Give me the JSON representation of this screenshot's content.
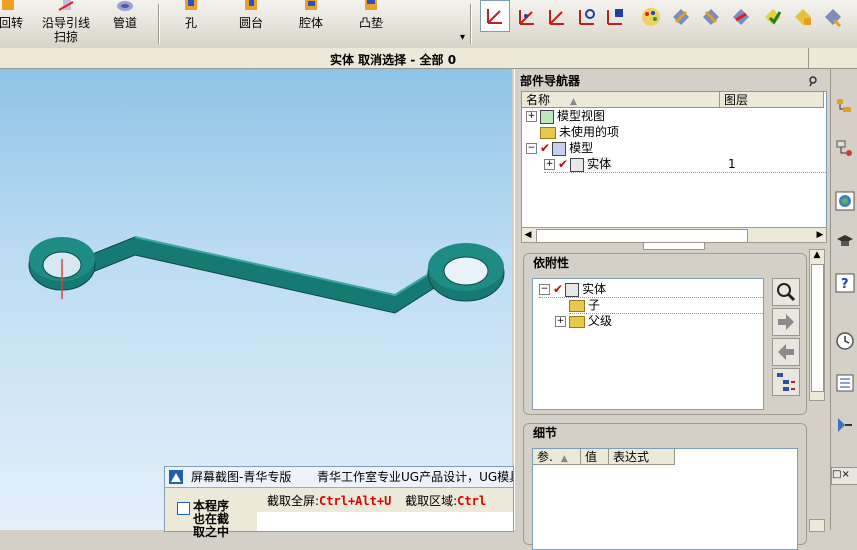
{
  "toolbar": {
    "buttons": [
      {
        "label": "回转",
        "icon": "revolve-icon"
      },
      {
        "label": "沿导引线\n扫掠",
        "icon": "sweep-along-guide-icon"
      },
      {
        "label": "管道",
        "icon": "tube-icon"
      },
      {
        "label": "孔",
        "icon": "hole-icon"
      },
      {
        "label": "圆台",
        "icon": "boss-icon"
      },
      {
        "label": "腔体",
        "icon": "pocket-icon"
      },
      {
        "label": "凸垫",
        "icon": "pad-icon"
      }
    ],
    "dropdown": "▾"
  },
  "status": {
    "text": "实体 取消选择 - 全部 0"
  },
  "navigator": {
    "title": "部件导航器",
    "columns": {
      "name": "名称",
      "layer": "图层"
    },
    "tree": [
      {
        "expander": "+",
        "label": "模型视图",
        "checked": false
      },
      {
        "expander": "",
        "label": "未使用的项",
        "checked": false
      },
      {
        "expander": "−",
        "label": "模型",
        "checked": true
      },
      {
        "expander": "+",
        "label": "实体",
        "checked": true,
        "layer": "1"
      }
    ]
  },
  "dependency": {
    "title": "依附性",
    "tree": [
      {
        "expander": "−",
        "label": "实体",
        "checked": true
      },
      {
        "expander": "",
        "label": "子"
      },
      {
        "expander": "+",
        "label": "父级"
      }
    ]
  },
  "details": {
    "title": "细节",
    "columns": [
      "参.",
      "值",
      "表达式"
    ]
  },
  "capture": {
    "title": "屏幕截图-青华专版",
    "subtitle": "青华工作室专业UG产品设计，UG模具设",
    "checkbox_label": "本程序也在截取之中",
    "fullscreen_label": "截取全屏:",
    "fullscreen_key": "Ctrl+Alt+U",
    "region_label": "截取区域:",
    "region_key": "Ctrl"
  },
  "colors": {
    "model": "#167a72",
    "viewport_top": "#8fc3e6",
    "accent_red": "#e00000"
  }
}
